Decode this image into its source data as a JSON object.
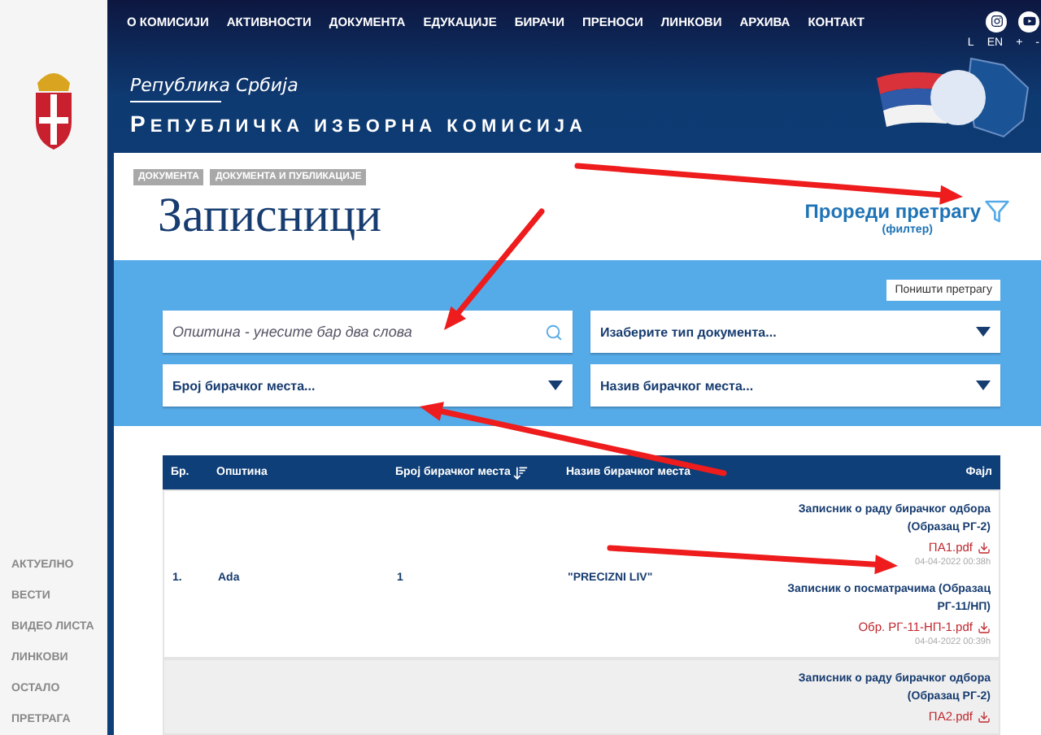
{
  "nav": {
    "items": [
      "О КОМИСИЈИ",
      "АКТИВНОСТИ",
      "ДОКУМЕНТА",
      "ЕДУКАЦИЈЕ",
      "БИРАЧИ",
      "ПРЕНОСИ",
      "ЛИНКОВИ",
      "АРХИВА",
      "КОНТАКТ"
    ],
    "lang": [
      "L",
      "EN",
      "+",
      "-"
    ]
  },
  "header": {
    "subtitle": "Република Србија",
    "title": "РЕПУБЛИЧКА ИЗБОРНА КОМИСИЈА"
  },
  "sidebar": {
    "items": [
      "АКТУЕЛНО",
      "ВЕСТИ",
      "ВИДЕО ЛИСТА",
      "ЛИНКОВИ",
      "ОСТАЛО",
      "ПРЕТРАГА"
    ]
  },
  "breadcrumbs": [
    "ДОКУМЕНТА",
    "ДОКУМЕНТА И ПУБЛИКАЦИЈЕ"
  ],
  "page_title": "Записници",
  "filter_link": {
    "label": "Прореди претрагу",
    "note": "(филтер)"
  },
  "search": {
    "clear_button": "Поништи претрагу",
    "fields": [
      {
        "kind": "search",
        "placeholder": "Општина - унесите бар два слова"
      },
      {
        "kind": "select",
        "value": "Изаберите тип документа..."
      },
      {
        "kind": "select",
        "value": "Број бирачког места..."
      },
      {
        "kind": "select",
        "value": "Назив бирачког места..."
      }
    ]
  },
  "table": {
    "columns": [
      "Бр.",
      "Општина",
      "Број бирачког места",
      "Назив бирачког места",
      "Фајл"
    ],
    "rows": [
      {
        "number": "1.",
        "municipality": "Ada",
        "place_number": "1",
        "place_name": "\"PRECIZNI LIV\"",
        "files": [
          {
            "title": "Записник о раду бирачког одбора (Образац РГ-2)",
            "filename": "ПА1.pdf",
            "date": "04-04-2022 00:38h"
          },
          {
            "title": "Записник о посматрачима (Образац РГ-11/НП)",
            "filename": "Обр. РГ-11-НП-1.pdf",
            "date": "04-04-2022 00:39h"
          }
        ]
      },
      {
        "files": [
          {
            "title": "Записник о раду бирачког одбора (Образац РГ-2)",
            "filename": "ПА2.pdf"
          }
        ]
      }
    ]
  }
}
